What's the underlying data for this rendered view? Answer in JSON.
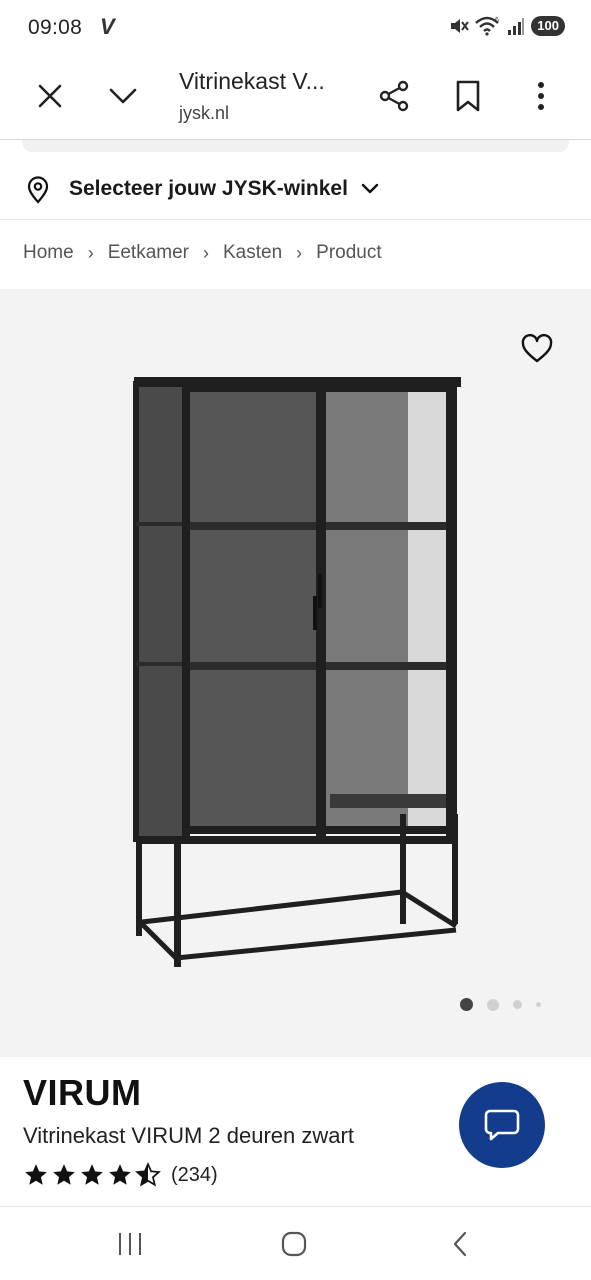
{
  "status_bar": {
    "time": "09:08",
    "carrier_glyph": "V",
    "battery": "100",
    "icons": [
      "mute-icon",
      "wifi-icon",
      "signal-icon",
      "battery-icon"
    ]
  },
  "browser": {
    "title": "Vitrinekast V...",
    "url": "jysk.nl",
    "icons": [
      "close-icon",
      "chevron-down-icon",
      "share-icon",
      "bookmark-icon",
      "more-vert-icon"
    ]
  },
  "store_selector": {
    "label": "Selecteer jouw JYSK-winkel"
  },
  "breadcrumb": {
    "items": [
      "Home",
      "Eetkamer",
      "Kasten",
      "Product"
    ],
    "separator": "›"
  },
  "gallery": {
    "image_alt": "Vitrinekast VIRUM",
    "total_images": 4,
    "active_index": 0
  },
  "product": {
    "brand": "VIRUM",
    "name": "Vitrinekast VIRUM 2 deuren zwart",
    "rating": 4.5,
    "max_rating": 5,
    "review_count": "(234)"
  },
  "colors": {
    "chat_button": "#143c8c",
    "image_bg": "#f3f3f3",
    "cabinet": "#1f1f1f"
  },
  "nav": {
    "icons": [
      "recents-icon",
      "home-icon",
      "back-icon"
    ]
  }
}
